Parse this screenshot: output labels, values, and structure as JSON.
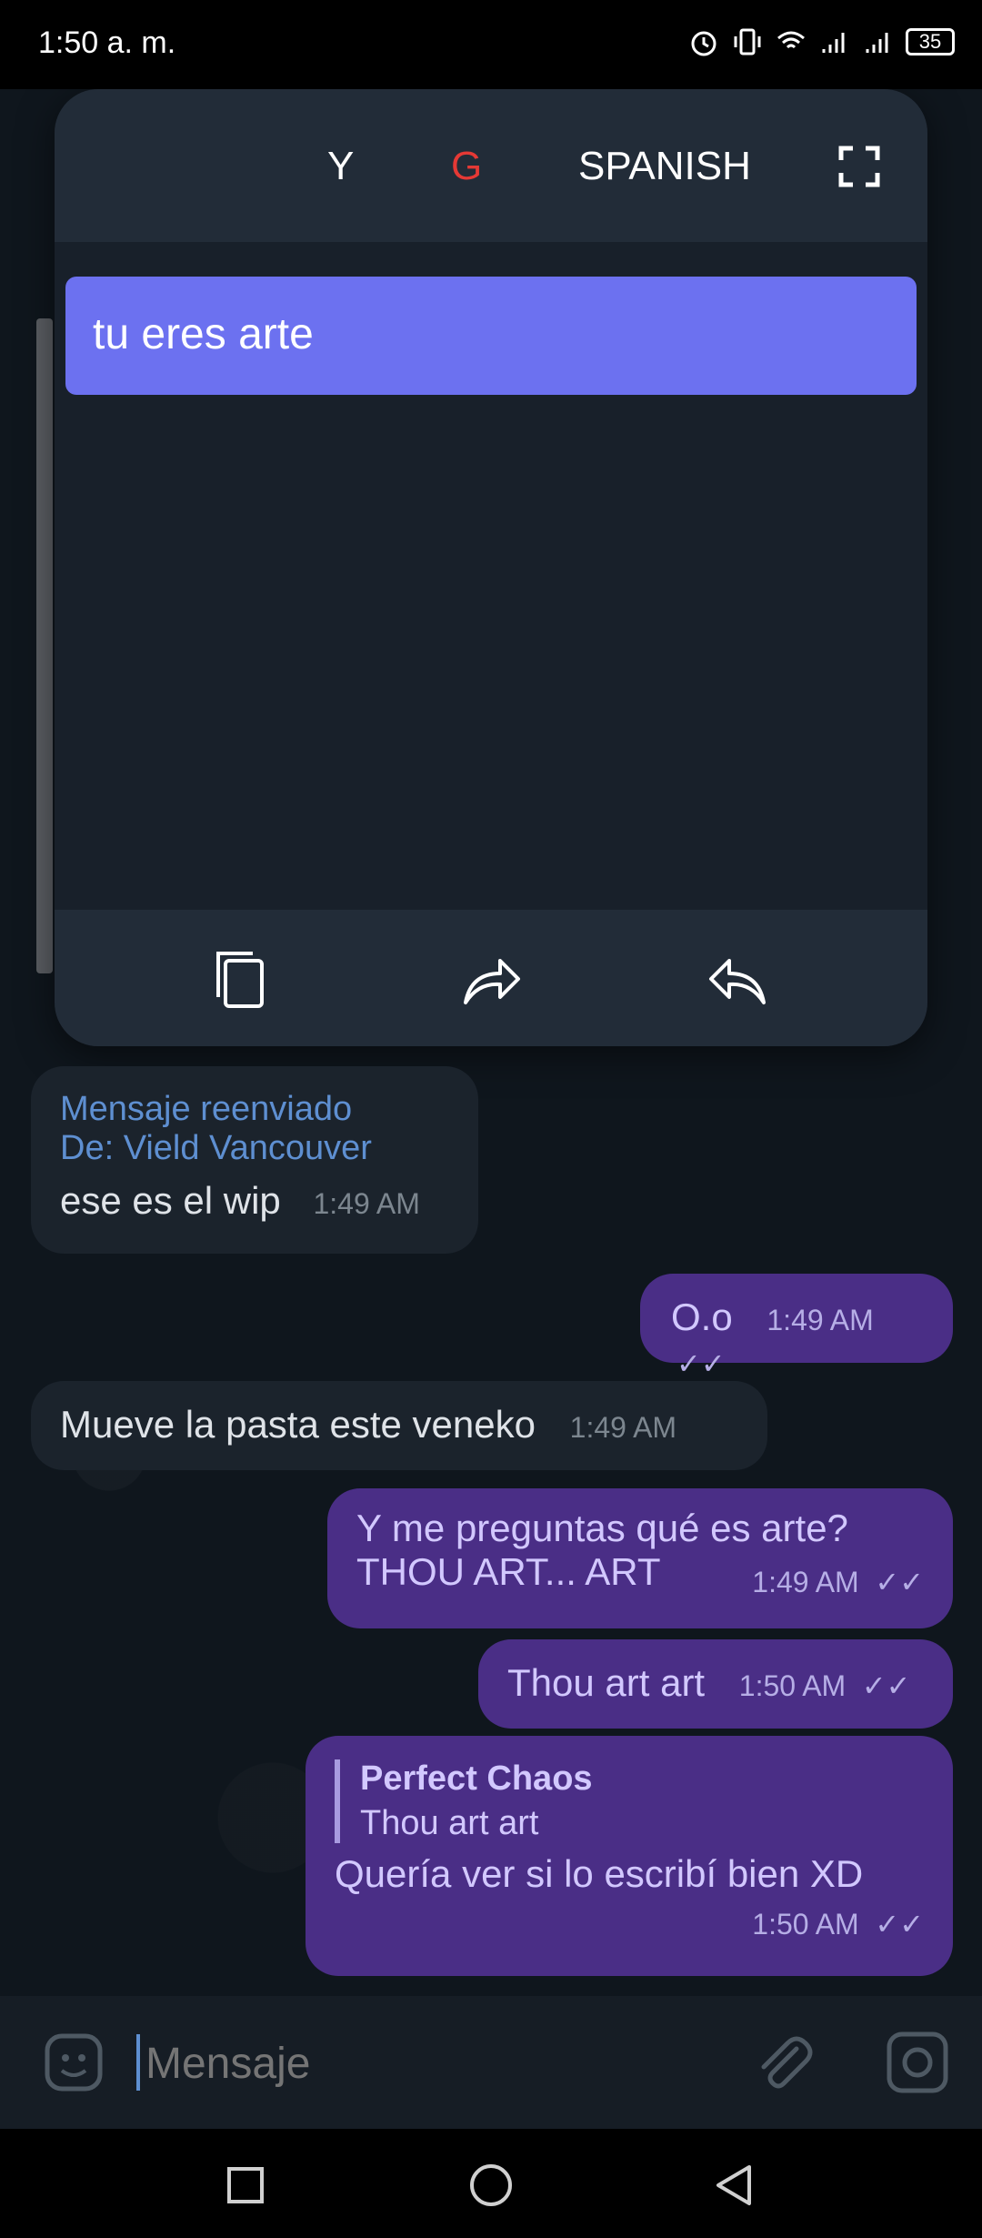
{
  "status_bar": {
    "time": "1:50 a. m.",
    "battery": "35"
  },
  "popup": {
    "header": {
      "y_label": "Y",
      "g_label": "G",
      "language": "SPANISH"
    },
    "translation_text": "tu eres arte",
    "footer": {
      "copy_icon": "copy-icon",
      "forward_icon": "forward-icon",
      "reply_icon": "reply-icon"
    }
  },
  "messages": [
    {
      "direction": "in",
      "forwarded_label": "Mensaje reenviado",
      "forwarded_from": "De: Vield Vancouver",
      "text": "ese es el wip",
      "time": "1:49 AM"
    },
    {
      "direction": "out",
      "text": "O.o",
      "time": "1:49 AM"
    },
    {
      "direction": "in",
      "text": "Mueve la pasta este veneko",
      "time": "1:49 AM"
    },
    {
      "direction": "out",
      "text_line1": "Y me preguntas qué es arte?",
      "text_line2": "THOU ART... ART",
      "time": "1:49 AM"
    },
    {
      "direction": "out",
      "text": "Thou art art",
      "time": "1:50 AM"
    },
    {
      "direction": "out",
      "reply_author": "Perfect Chaos",
      "reply_text": "Thou art art",
      "text": "Quería ver si lo escribí bien XD",
      "time": "1:50 AM"
    }
  ],
  "input": {
    "placeholder": "Mensaje"
  },
  "colors": {
    "accent_out_bubble": "#4a2e86",
    "translation_bg": "#6c71f0",
    "g_label_color": "#e53935"
  }
}
